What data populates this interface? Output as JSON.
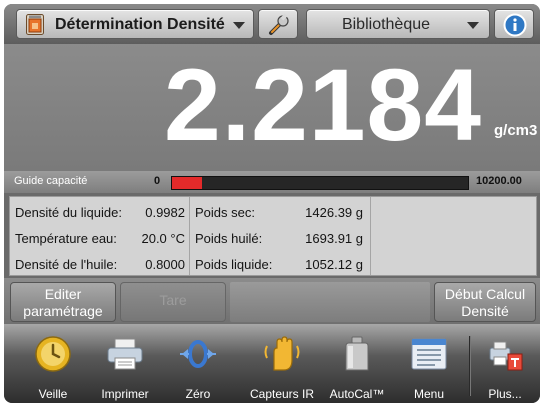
{
  "topbar": {
    "app_title": "Détermination Densité",
    "library_label": "Bibliothèque",
    "icons": {
      "app": "density-app-icon",
      "settings": "wrench-icon",
      "info": "info-icon"
    }
  },
  "reading": {
    "value": "2.2184",
    "unit": "g/cm3"
  },
  "capacity": {
    "label": "Guide capacité",
    "min": "0",
    "max": "10200.00",
    "fill_fraction": 0.1,
    "fill_color": "#e32a2a"
  },
  "info": {
    "left": [
      {
        "label": "Densité du liquide:",
        "value": "0.9982"
      },
      {
        "label": "Température eau:",
        "value": "20.0 °C"
      },
      {
        "label": "Densité de l'huile:",
        "value": "0.8000"
      }
    ],
    "middle": [
      {
        "label": "Poids sec:",
        "value": "1426.39 g"
      },
      {
        "label": "Poids huilé:",
        "value": "1693.91 g"
      },
      {
        "label": "Poids liquide:",
        "value": "1052.12 g"
      }
    ]
  },
  "actions": {
    "edit_line1": "Editer",
    "edit_line2": "paramétrage",
    "tare": "Tare",
    "start_line1": "Début Calcul",
    "start_line2": "Densité"
  },
  "nav": [
    {
      "label": "Veille",
      "icon": "standby-icon"
    },
    {
      "label": "Imprimer",
      "icon": "printer-icon"
    },
    {
      "label": "Zéro",
      "icon": "zero-icon"
    },
    {
      "label": "Capteurs IR",
      "icon": "ir-sensor-icon"
    },
    {
      "label": "AutoCal™",
      "icon": "autocal-icon"
    },
    {
      "label": "Menu",
      "icon": "menu-icon"
    },
    {
      "label": "Plus...",
      "icon": "more-icon"
    }
  ]
}
